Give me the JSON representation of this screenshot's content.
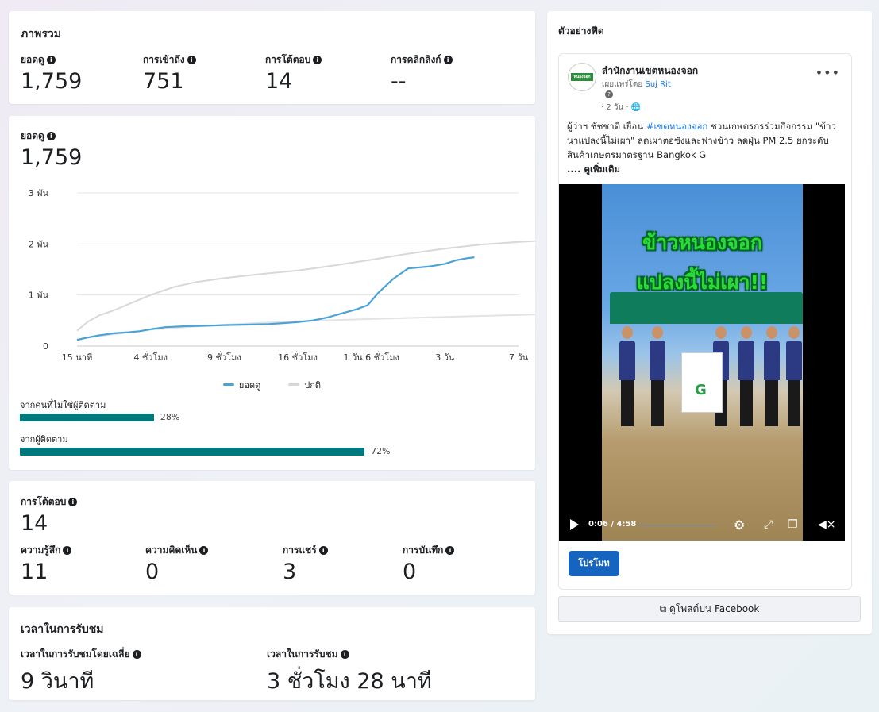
{
  "overview": {
    "title": "ภาพรวม",
    "metrics": [
      {
        "label": "ยอดดู",
        "value": "1,759"
      },
      {
        "label": "การเข้าถึง",
        "value": "751"
      },
      {
        "label": "การโต้ตอบ",
        "value": "14"
      },
      {
        "label": "การคลิกลิงก์",
        "value": "--"
      }
    ]
  },
  "views_card": {
    "label": "ยอดดู",
    "value": "1,759",
    "audience": [
      {
        "label": "จากคนที่ไม่ใช่ผู้ติดตาม",
        "percent_text": "28%",
        "percent": 28
      },
      {
        "label": "จากผู้ติดตาม",
        "percent_text": "72%",
        "percent": 72
      }
    ]
  },
  "chart_data": {
    "type": "line",
    "y_ticks": [
      "0",
      "1 พัน",
      "2 พัน",
      "3 พัน"
    ],
    "ylim": [
      0,
      3000
    ],
    "x_tick_labels": [
      "15 นาที",
      "4 ชั่วโมง",
      "9 ชั่วโมง",
      "16 ชั่วโมง",
      "1 วัน 6 ชั่วโมง",
      "3 วัน",
      "7 วัน"
    ],
    "x_tick_index": [
      0,
      1,
      2,
      3,
      4,
      5,
      6
    ],
    "series": [
      {
        "name": "ยอดดู",
        "color": "#4aa3d6",
        "x": [
          0,
          0.15,
          0.3,
          0.5,
          0.7,
          0.85,
          1.0,
          1.2,
          1.5,
          1.8,
          2.0,
          2.3,
          2.6,
          2.8,
          3.0,
          3.2,
          3.4,
          3.6,
          3.8,
          3.95,
          4.1,
          4.3,
          4.5,
          4.8,
          5.0,
          5.15,
          5.3,
          5.4
        ],
        "y": [
          120,
          170,
          210,
          250,
          270,
          290,
          330,
          370,
          390,
          400,
          410,
          420,
          430,
          450,
          470,
          500,
          560,
          640,
          720,
          800,
          1050,
          1320,
          1520,
          1560,
          1610,
          1680,
          1720,
          1740
        ]
      },
      {
        "name": "ปกติ",
        "color": "#d8d8dc",
        "x": [
          0,
          0.15,
          0.3,
          0.5,
          0.7,
          1.0,
          1.3,
          1.6,
          2.0,
          2.5,
          3.0,
          3.5,
          4.0,
          4.5,
          5.0,
          5.5,
          6.0,
          6.5,
          7.0
        ],
        "y": [
          300,
          480,
          600,
          700,
          820,
          1000,
          1150,
          1250,
          1330,
          1410,
          1480,
          1580,
          1690,
          1810,
          1910,
          1990,
          2040,
          2080,
          2110
        ]
      },
      {
        "name": "",
        "color": "#e3e3e6",
        "x": [
          0,
          1.0,
          2.0,
          3.0,
          4.0,
          5.0,
          6.0,
          7.0
        ],
        "y": [
          140,
          320,
          420,
          490,
          530,
          570,
          610,
          650
        ]
      }
    ]
  },
  "engagement": {
    "label": "การโต้ตอบ",
    "value": "14",
    "items": [
      {
        "label": "ความรู้สึก",
        "value": "11"
      },
      {
        "label": "ความคิดเห็น",
        "value": "0"
      },
      {
        "label": "การแชร์",
        "value": "3"
      },
      {
        "label": "การบันทึก",
        "value": "0"
      }
    ]
  },
  "watch": {
    "title": "เวลาในการรับชม",
    "items": [
      {
        "label": "เวลาในการรับชมโดยเฉลี่ย",
        "value": "9 วินาที"
      },
      {
        "label": "เวลาในการรับชม",
        "value": "3 ชั่วโมง 28 นาที"
      }
    ]
  },
  "feed": {
    "title": "ตัวอย่างฟีด",
    "page_name": "สำนักงานเขตหนองจอก",
    "avatar_text": "หนองจอก",
    "published_by_prefix": "เผยแพร่โดย",
    "published_by_name": "Suj Rit",
    "time": "· 2 วัน ·",
    "text_1": "ผู้ว่าฯ ชัชชาติ เยือน ",
    "hashtag": "#เขตหนองจอก",
    "text_2": " ชวนเกษตรกรร่วมกิจกรรม \"ข้าวนาแปลงนี้ไม่เผา\" ลดเผาตอซังและฟางข้าว ลดฝุ่น PM 2.5 ยกระดับสินค้าเกษตรมาตรฐาน Bangkok G",
    "see_more": ".... ดูเพิ่มเติม",
    "video_title_1": "ข้าวหนองจอก",
    "video_title_2": "แปลงนี้ไม่เผา!!",
    "video_time": "0:06 / 4:58",
    "promote": "โปรโมท",
    "view_on_facebook": "ดูโพสต์บน Facebook"
  },
  "colors": {
    "views": "#4aa3d6",
    "typical": "#d8d8dc",
    "audience_bar": "#00797e",
    "promote": "#1565c0"
  }
}
